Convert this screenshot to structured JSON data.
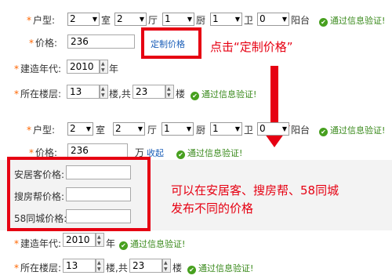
{
  "top": {
    "layout_label": "户型:",
    "rooms": [
      "2",
      "2",
      "1",
      "1",
      "0"
    ],
    "room_units": [
      "室",
      "厅",
      "厨",
      "卫",
      "阳台"
    ],
    "verified": "通过信息验证!",
    "price_label": "价格:",
    "price_value": "236",
    "custom_price_link": "定制价格",
    "year_label": "建造年代:",
    "year_value": "2010",
    "year_unit": "年",
    "floor_label": "所在楼层:",
    "floor_value": "13",
    "floor_mid": "楼,共",
    "floor_total": "23",
    "floor_unit": "楼"
  },
  "annotation_click": "点击“定制价格”",
  "bottom": {
    "layout_label": "户型:",
    "rooms": [
      "2",
      "2",
      "1",
      "1",
      "0"
    ],
    "room_units": [
      "室",
      "厅",
      "厨",
      "卫",
      "阳台"
    ],
    "verified": "通过信息验证!",
    "price_label": "价格:",
    "price_value": "236",
    "price_unit": "万",
    "collapse_link": "收起",
    "custom_prices": [
      {
        "label": "安居客价格:",
        "value": ""
      },
      {
        "label": "搜房帮价格:",
        "value": ""
      },
      {
        "label": "58同城价格:",
        "value": ""
      }
    ],
    "year_label": "建造年代:",
    "year_value": "2010",
    "year_unit": "年",
    "floor_label": "所在楼层:",
    "floor_value": "13",
    "floor_mid": "楼,共",
    "floor_total": "23",
    "floor_unit": "楼"
  },
  "annotation_platforms_line1": "可以在安居客、搜房帮、58同城",
  "annotation_platforms_line2": "发布不同的价格",
  "colors": {
    "accent_red": "#e60012",
    "ok_green": "#47a01f",
    "link_blue": "#1a5eb8"
  }
}
